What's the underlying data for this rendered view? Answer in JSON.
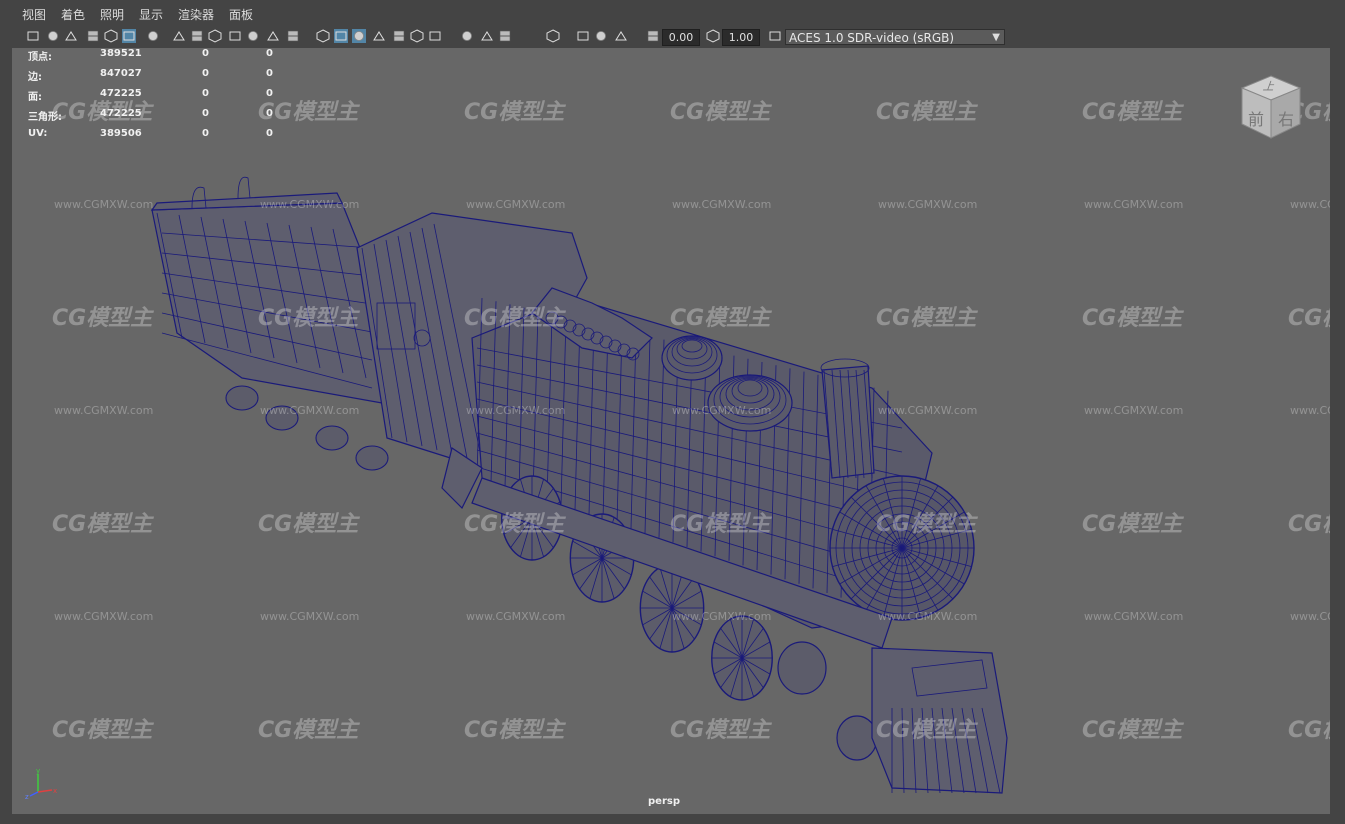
{
  "menu": [
    "视图",
    "着色",
    "照明",
    "显示",
    "渲染器",
    "面板"
  ],
  "toolbar": {
    "exposure": "0.00",
    "gamma": "1.00",
    "colorspace": "ACES 1.0 SDR-video (sRGB)",
    "icons": [
      "camera-select-icon",
      "camera-attributes-icon",
      "bookmark-icon",
      "image-plane-icon",
      "pan-zoom-icon",
      "grease-pencil-icon",
      "grid-icon",
      "film-gate-icon",
      "resolution-gate-icon",
      "gate-mask-icon",
      "field-chart-icon",
      "safe-action-icon",
      "safe-title-icon",
      "wireframe-icon",
      "smooth-shade-icon",
      "default-material-icon",
      "wireframe-on-shaded-icon",
      "textured-icon",
      "lights-icon",
      "shadows-icon",
      "screen-space-ao-icon",
      "motion-blur-icon",
      "anti-aliasing-icon",
      "depth-of-field-icon",
      "isolate-select-icon",
      "xray-icon",
      "xray-joints-icon",
      "backface-culling-icon",
      "exposure-icon",
      "gamma-icon",
      "color-management-icon"
    ]
  },
  "hud": {
    "rows": [
      {
        "label": "顶点:",
        "v1": "389521",
        "v2": "0",
        "v3": "0"
      },
      {
        "label": "边:",
        "v1": "847027",
        "v2": "0",
        "v3": "0"
      },
      {
        "label": "面:",
        "v1": "472225",
        "v2": "0",
        "v3": "0"
      },
      {
        "label": "三角形:",
        "v1": "472225",
        "v2": "0",
        "v3": "0"
      },
      {
        "label": "UV:",
        "v1": "389506",
        "v2": "0",
        "v3": "0"
      }
    ]
  },
  "viewcube": {
    "top": "上",
    "front": "前",
    "right": "右"
  },
  "camera_label": "persp",
  "watermark": {
    "text": "CG模型主",
    "url": "www.CGMXW.com"
  },
  "colors": {
    "viewport_bg": "#676767",
    "wire": "#1a1a7a",
    "ui_bg": "#444444"
  }
}
